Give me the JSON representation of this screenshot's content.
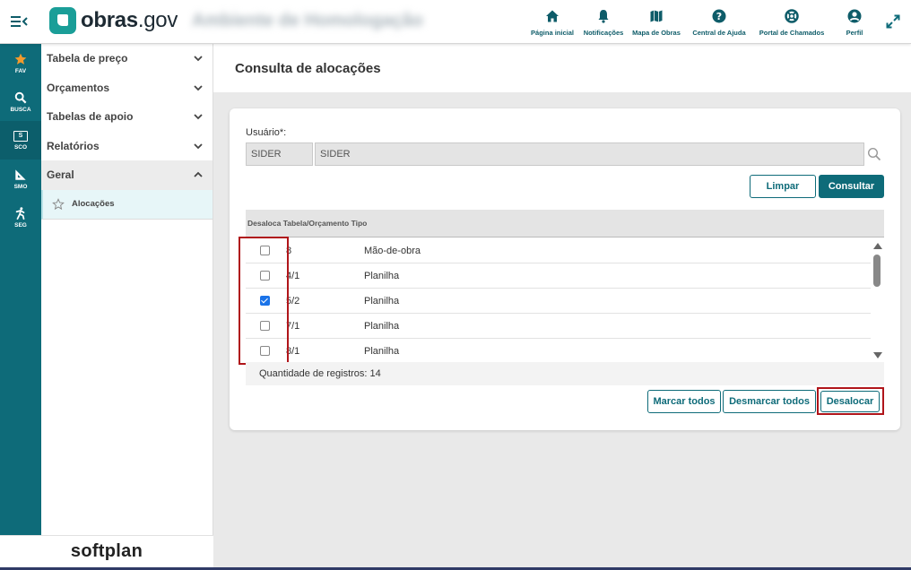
{
  "header": {
    "logo_text_bold": "obras",
    "logo_text_rest": ".gov",
    "environment_name": "Ambiente de Homologação",
    "nav": [
      {
        "label": "Página inicial",
        "icon": "home-icon"
      },
      {
        "label": "Notificações",
        "icon": "bell-icon"
      },
      {
        "label": "Mapa de Obras",
        "icon": "map-icon"
      },
      {
        "label": "Central de Ajuda",
        "icon": "help-icon"
      },
      {
        "label": "Portal de Chamados",
        "icon": "lifebuoy-icon"
      },
      {
        "label": "Perfil",
        "icon": "user-icon"
      }
    ]
  },
  "rail": {
    "items": [
      {
        "label": "FAV",
        "icon": "star-icon"
      },
      {
        "label": "BUSCA",
        "icon": "search-icon"
      },
      {
        "label": "SCO",
        "icon": "sco-icon",
        "box_text": "S"
      },
      {
        "label": "SMO",
        "icon": "ruler-icon"
      },
      {
        "label": "SEG",
        "icon": "person-icon"
      }
    ]
  },
  "sidebar": {
    "items": [
      {
        "label": "Tabela de preço"
      },
      {
        "label": "Orçamentos"
      },
      {
        "label": "Tabelas de apoio"
      },
      {
        "label": "Relatórios"
      },
      {
        "label": "Geral"
      }
    ],
    "sub_item": "Alocações"
  },
  "brand": "softplan",
  "page": {
    "title": "Consulta de alocações"
  },
  "form": {
    "user_label": "Usuário*:",
    "user_code": "SIDER",
    "user_name": "SIDER",
    "limpar_label": "Limpar",
    "consultar_label": "Consultar"
  },
  "table": {
    "header": "Desaloca Tabela/Orçamento Tipo",
    "rows": [
      {
        "tabela": "8",
        "tipo": "Mão-de-obra",
        "checked": false
      },
      {
        "tabela": "4/1",
        "tipo": "Planilha",
        "checked": false
      },
      {
        "tabela": "5/2",
        "tipo": "Planilha",
        "checked": true
      },
      {
        "tabela": "7/1",
        "tipo": "Planilha",
        "checked": false
      },
      {
        "tabela": "8/1",
        "tipo": "Planilha",
        "checked": false
      }
    ],
    "count_label": "Quantidade de registros: 14"
  },
  "actions": {
    "marcar_label": "Marcar todos",
    "desmarcar_label": "Desmarcar todos",
    "desalocar_label": "Desalocar"
  },
  "colors": {
    "primary": "#0e6b79",
    "highlight": "#b0151a",
    "checkbox_checked": "#1a73e8"
  }
}
